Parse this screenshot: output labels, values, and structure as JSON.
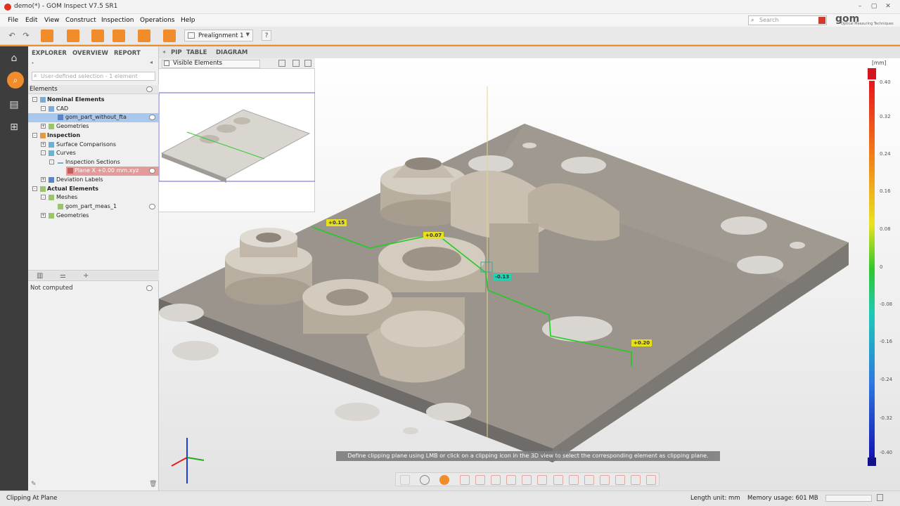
{
  "window": {
    "title": "demo(*) - GOM Inspect V7.5 SR1"
  },
  "menu": [
    "File",
    "Edit",
    "View",
    "Construct",
    "Inspection",
    "Operations",
    "Help"
  ],
  "search": {
    "placeholder": "Search"
  },
  "logo": {
    "text": "gom",
    "subtitle": "Optical Measuring Techniques"
  },
  "toolbar": {
    "alignment": "Prealignment 1",
    "help": "?"
  },
  "explorer": {
    "tabs": [
      "EXPLORER",
      "OVERVIEW",
      "REPORT"
    ],
    "filter_placeholder": "User-defined selection - 1 element",
    "elements_header": "Elements",
    "tree": [
      {
        "label": "Nominal Elements",
        "bold": true
      },
      {
        "label": "CAD"
      },
      {
        "label": "gom_part_without_fta"
      },
      {
        "label": "Geometries"
      },
      {
        "label": "Inspection",
        "bold": true
      },
      {
        "label": "Surface Comparisons"
      },
      {
        "label": "Curves"
      },
      {
        "label": "Inspection Sections"
      },
      {
        "label": "Plane X +0.00 mm.xyz"
      },
      {
        "label": "Deviation Labels"
      },
      {
        "label": "Actual Elements",
        "bold": true
      },
      {
        "label": "Meshes"
      },
      {
        "label": "gom_part_meas_1"
      },
      {
        "label": "Geometries"
      }
    ],
    "properties_status": "Not computed"
  },
  "view_tabs": [
    "PIP",
    "TABLE",
    "DIAGRAM"
  ],
  "pip": {
    "selector": "Visible Elements"
  },
  "viewport": {
    "unit": "[mm]",
    "colorbar": [
      "0.40",
      "0.32",
      "0.24",
      "0.16",
      "0.08",
      "0",
      "-0.08",
      "-0.16",
      "-0.24",
      "-0.32",
      "-0.40"
    ],
    "labels": [
      "+0.15",
      "+0.07",
      "-0.13",
      "+0.20"
    ],
    "hint": "Define clipping plane using LMB or click on a clipping icon in the 3D view to select the corresponding element as clipping plane."
  },
  "colors": {
    "accent": "#f08c2a",
    "section_line": "#22cc22",
    "brand": "#d23a2b"
  },
  "status": {
    "left": "Clipping At Plane",
    "length_unit": "Length unit: mm",
    "memory": "Memory usage: 601 MB"
  }
}
